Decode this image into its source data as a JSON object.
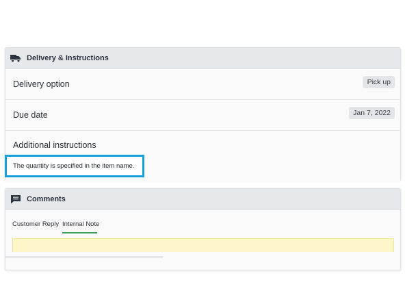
{
  "delivery": {
    "header_title": "Delivery & Instructions",
    "delivery_option_label": "Delivery option",
    "delivery_option_value": "Pick up",
    "due_date_label": "Due date",
    "due_date_value": "Jan 7, 2022",
    "additional_instructions_label": "Additional instructions",
    "instructions_text": "The quantity is specified in the item name."
  },
  "comments": {
    "header_title": "Comments",
    "tabs": [
      {
        "label": "Customer Reply"
      },
      {
        "label": "Internal Note"
      }
    ]
  },
  "colors": {
    "highlight": "#1a9ed9",
    "active_tab_underline": "#3c9a5f",
    "note_background": "#fdf6c9"
  },
  "icons": {
    "delivery": "truck-icon",
    "comments": "comment-icon"
  }
}
